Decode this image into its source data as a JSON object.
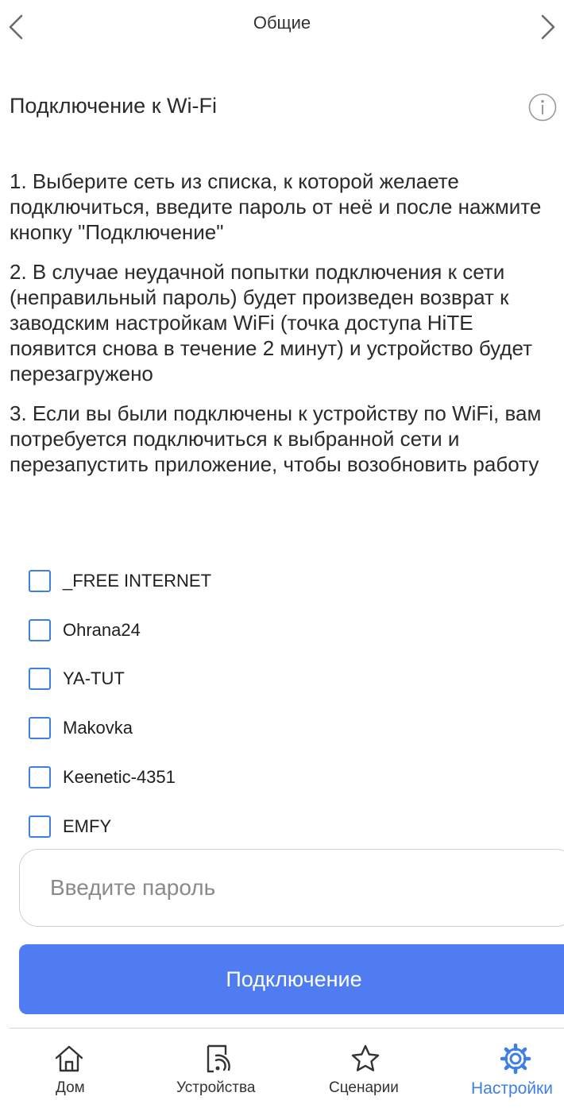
{
  "header": {
    "title": "Общие",
    "back_icon": "chevron-left-icon",
    "forward_icon": "chevron-right-icon"
  },
  "section": {
    "title": "Подключение к Wi-Fi",
    "info_icon": "info-icon"
  },
  "instructions": [
    "1. Выберите сеть из списка, к которой желаете подключиться, введите пароль от неё и после нажмите кнопку \"Подключение\"",
    "2. В случае неудачной попытки подключения к сети (неправильный пароль) будет произведен возврат к заводским настройкам WiFi (точка доступа HiTE появится снова в течение 2 минут) и устройство будет перезагружено",
    "3. Если вы были подключены к устройству по WiFi, вам потребуется подключиться к выбранной сети и перезапустить приложение, чтобы возобновить работу"
  ],
  "networks": [
    {
      "name": "_FREE INTERNET",
      "checked": false
    },
    {
      "name": "Ohrana24",
      "checked": false
    },
    {
      "name": "YA-TUT",
      "checked": false
    },
    {
      "name": "Makovka",
      "checked": false
    },
    {
      "name": "Keenetic-4351",
      "checked": false
    },
    {
      "name": "EMFY",
      "checked": false
    }
  ],
  "password": {
    "placeholder": "Введите пароль",
    "value": ""
  },
  "connect_button": {
    "label": "Подключение"
  },
  "tabbar": {
    "tabs": [
      {
        "label": "Дом",
        "icon": "home-icon",
        "active": false
      },
      {
        "label": "Устройства",
        "icon": "devices-icon",
        "active": false
      },
      {
        "label": "Сценарии",
        "icon": "star-icon",
        "active": false
      },
      {
        "label": "Настройки",
        "icon": "gear-icon",
        "active": true
      }
    ]
  },
  "colors": {
    "accent": "#3d7fe4",
    "button": "#4f7cf0",
    "text": "#2a2a2a"
  }
}
